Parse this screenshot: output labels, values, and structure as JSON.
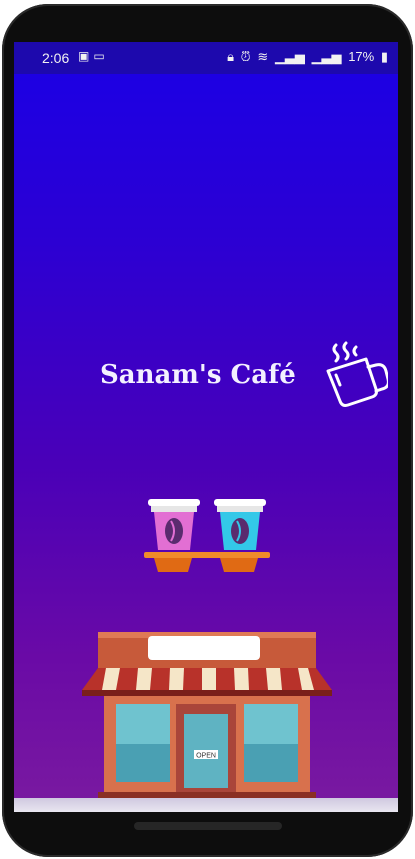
{
  "status_bar": {
    "time": "2:06",
    "left_icons": [
      "image-icon",
      "laptop-icon"
    ],
    "right_icons": [
      "lock-icon",
      "alarm-icon",
      "wifi-icon",
      "signal-icon",
      "signal-icon"
    ],
    "battery": "17%"
  },
  "splash": {
    "title": "Sanam's Café",
    "storefront_sign": "OPEN"
  },
  "colors": {
    "gradient_top": "#1a00e6",
    "gradient_bottom": "#7a1aa0"
  }
}
